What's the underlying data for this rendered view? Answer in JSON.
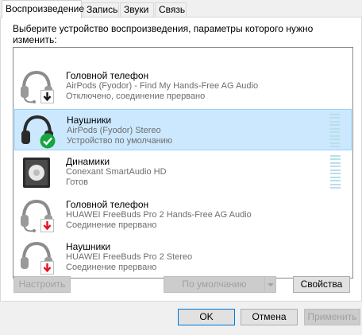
{
  "tabs": [
    {
      "label": "Воспроизведение",
      "active": true
    },
    {
      "label": "Запись",
      "active": false
    },
    {
      "label": "Звуки",
      "active": false
    },
    {
      "label": "Связь",
      "active": false
    }
  ],
  "instruction": "Выберите устройство воспроизведения, параметры которого нужно изменить:",
  "devices": [
    {
      "name": "Головной телефон",
      "detail": "AirPods (Fyodor) - Find My Hands-Free AG Audio",
      "status": "Отключено, соединение прервано",
      "icon": "headset-icon",
      "badge": "down-arrow-badge",
      "selected": false
    },
    {
      "name": "Наушники",
      "detail": "AirPods (Fyodor) Stereo",
      "status": "Устройство по умолчанию",
      "icon": "headphones-icon",
      "badge": "default-check-badge",
      "selected": true
    },
    {
      "name": "Динамики",
      "detail": "Conexant SmartAudio HD",
      "status": "Готов",
      "icon": "speaker-icon",
      "badge": "",
      "selected": false
    },
    {
      "name": "Головной телефон",
      "detail": "HUAWEI FreeBuds Pro 2 Hands-Free AG Audio",
      "status": "Соединение прервано",
      "icon": "headset-icon",
      "badge": "disconnected-badge",
      "selected": false
    },
    {
      "name": "Наушники",
      "detail": "HUAWEI FreeBuds Pro 2 Stereo",
      "status": "Соединение прервано",
      "icon": "headphones-icon",
      "badge": "disconnected-badge",
      "selected": false
    }
  ],
  "buttons": {
    "configure": "Настроить",
    "set_default": "По умолчанию",
    "properties": "Свойства",
    "ok": "OK",
    "cancel": "Отмена",
    "apply": "Применить"
  },
  "colors": {
    "selection_bg": "#cce8ff",
    "selection_border": "#99d1ff",
    "check_green": "#16a53f",
    "error_red": "#e81123",
    "meter": "#b9dfe9",
    "accent": "#0078d7"
  }
}
